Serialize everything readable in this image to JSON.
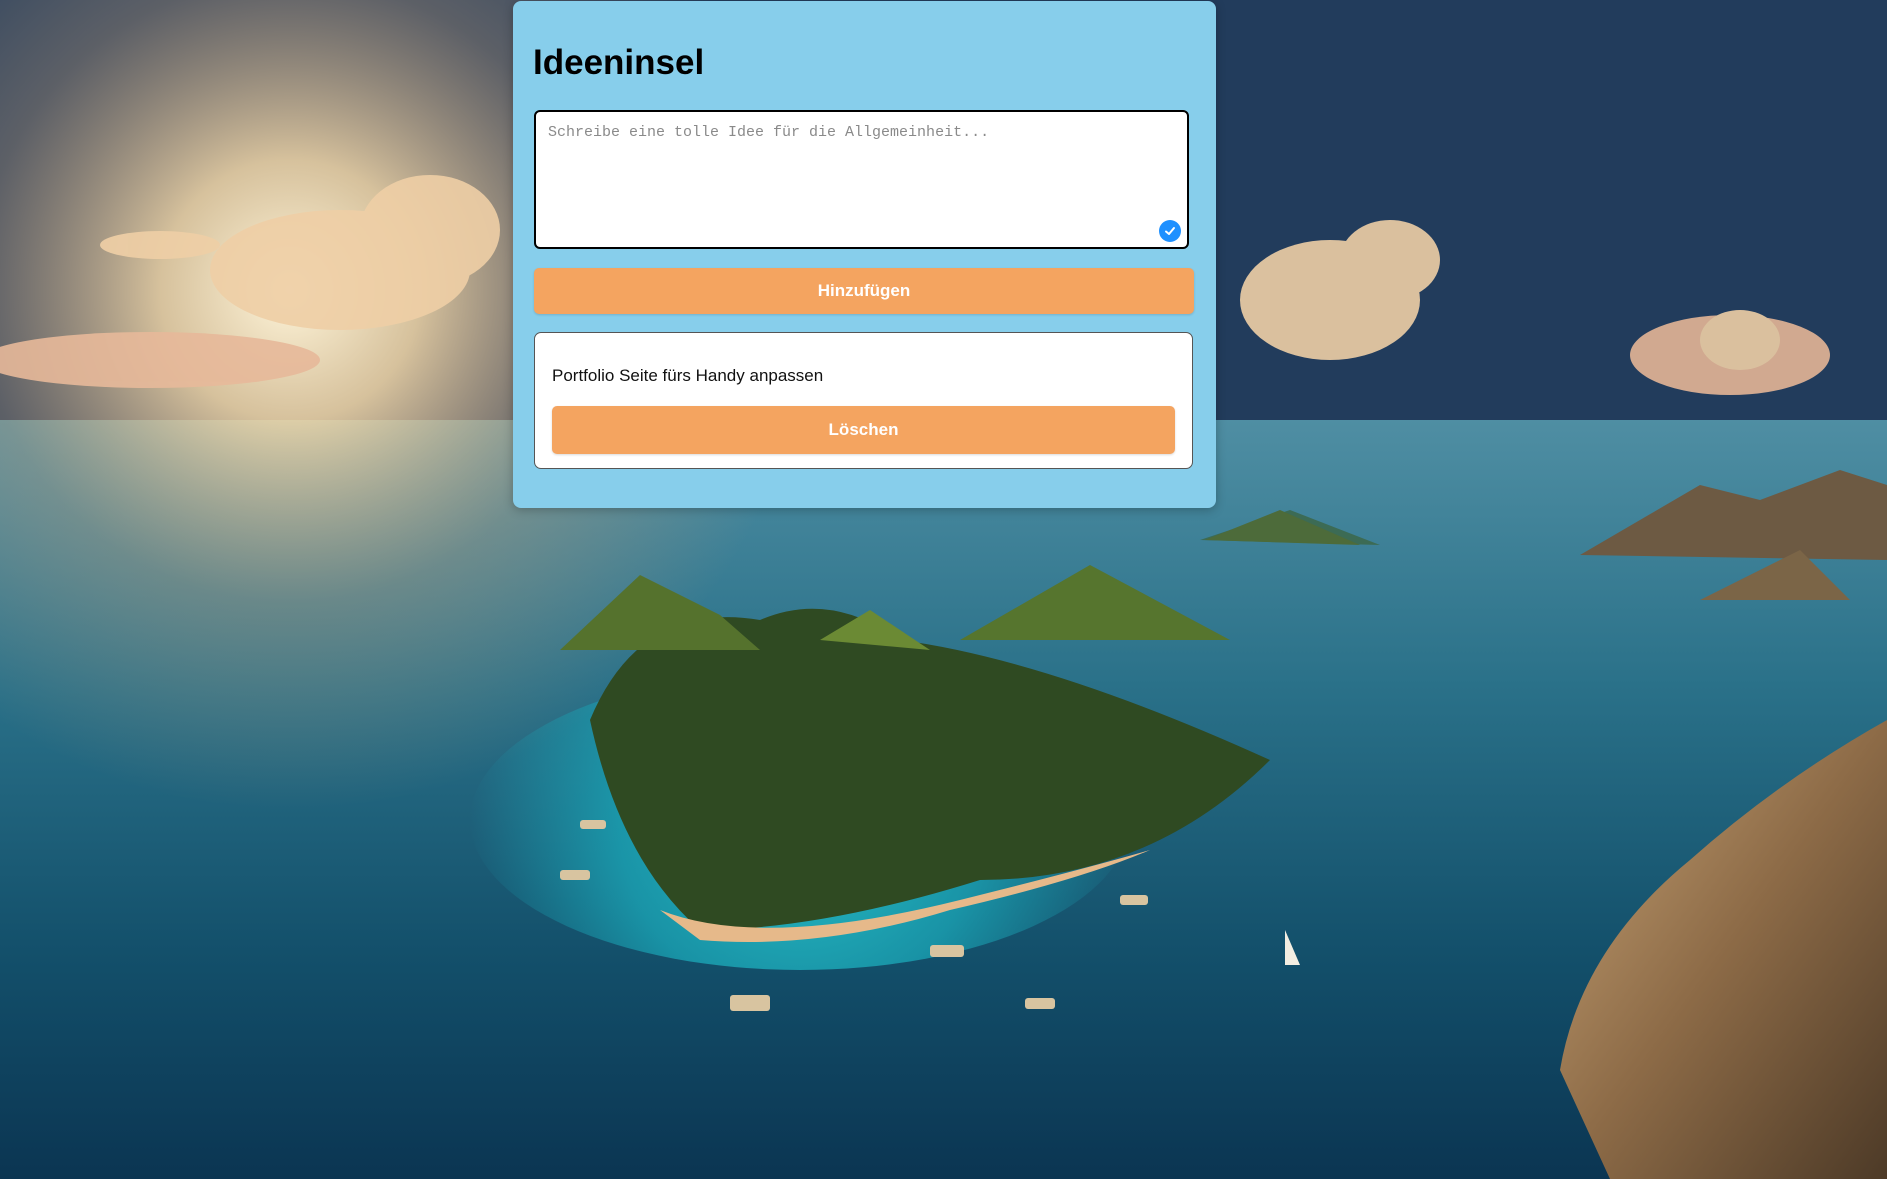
{
  "app": {
    "title": "Ideeninsel"
  },
  "input": {
    "placeholder": "Schreibe eine tolle Idee für die Allgemeinheit...",
    "value": ""
  },
  "actions": {
    "add_label": "Hinzufügen"
  },
  "ideas": [
    {
      "text": "Portfolio Seite fürs Handy anpassen",
      "delete_label": "Löschen"
    }
  ],
  "colors": {
    "panel_bg": "#87ceeb",
    "button_bg": "#f4a460",
    "button_text": "#ffffff",
    "badge": "#1e90ff"
  },
  "icons": {
    "input_badge": "check-circle-icon"
  }
}
